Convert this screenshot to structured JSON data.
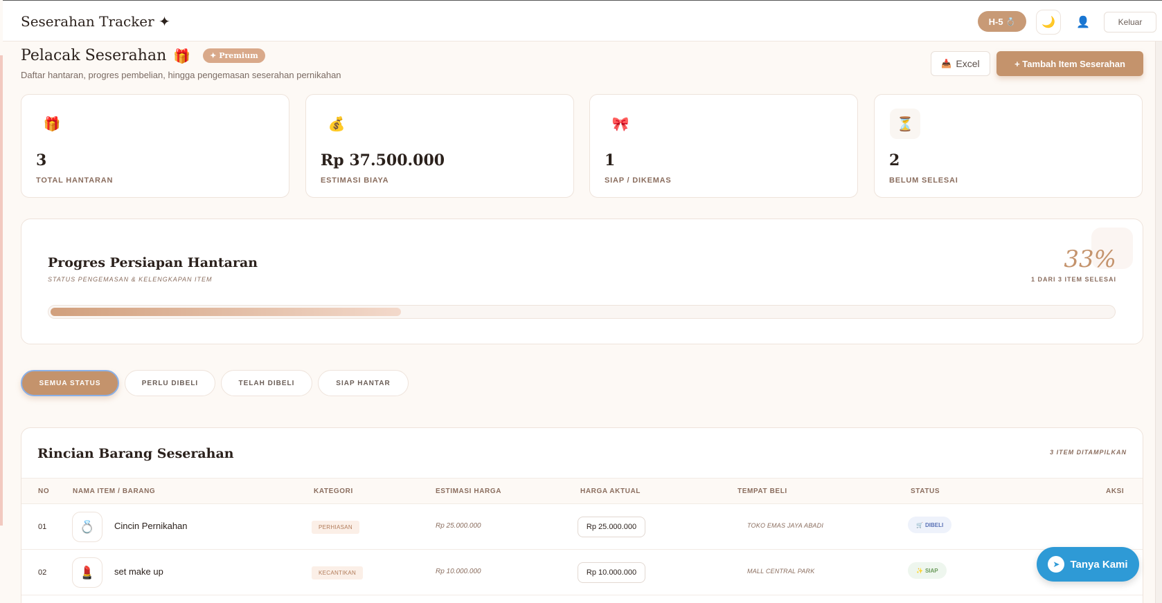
{
  "header": {
    "brand": "Seserahan Tracker ✦",
    "countdown": "H-5",
    "countdown_icon": "💍",
    "theme_icon": "🌙",
    "profile_icon": "👤",
    "logout_label": "Keluar"
  },
  "page": {
    "title": "Pelacak Seserahan",
    "title_icon": "🎁",
    "badge": "✦ Premium",
    "subtitle": "Daftar hantaran, progres pembelian, hingga pengemasan seserahan pernikahan",
    "excel_icon": "📥",
    "excel_label": "Excel",
    "add_label": "+   Tambah Item Seserahan"
  },
  "stats": [
    {
      "icon": "🎁",
      "value": "3",
      "label": "TOTAL HANTARAN"
    },
    {
      "icon": "💰",
      "value": "Rp 37.500.000",
      "label": "ESTIMASI BIAYA"
    },
    {
      "icon": "🎀",
      "value": "1",
      "label": "SIAP / DIKEMAS"
    },
    {
      "icon": "⏳",
      "value": "2",
      "label": "BELUM SELESAI"
    }
  ],
  "progress": {
    "title": "Progres Persiapan Hantaran",
    "subtitle": "STATUS PENGEMASAN & KELENGKAPAN ITEM",
    "percent_label": "33%",
    "percent_value": 33,
    "detail": "1 DARI 3 ITEM SELESAI"
  },
  "filters": [
    "SEMUA STATUS",
    "PERLU DIBELI",
    "TELAH DIBELI",
    "SIAP HANTAR"
  ],
  "table": {
    "title": "Rincian Barang Seserahan",
    "count": "3 ITEM DITAMPILKAN",
    "columns": [
      "NO",
      "NAMA ITEM / BARANG",
      "KATEGORI",
      "ESTIMASI HARGA",
      "HARGA AKTUAL",
      "TEMPAT BELI",
      "STATUS",
      "AKSI"
    ],
    "rows": [
      {
        "no": "01",
        "icon": "💍",
        "name": "Cincin Pernikahan",
        "category": "PERHIASAN",
        "estimate": "Rp 25.000.000",
        "actual": "Rp 25.000.000",
        "shop": "TOKO EMAS JAYA ABADI",
        "status_icon": "🛒",
        "status": "DIBELI"
      },
      {
        "no": "02",
        "icon": "💄",
        "name": "set make up",
        "category": "KECANTIKAN",
        "estimate": "Rp 10.000.000",
        "actual": "Rp 10.000.000",
        "shop": "MALL CENTRAL PARK",
        "status_icon": "✨",
        "status": "SIAP"
      }
    ]
  },
  "chat": {
    "icon": "➤",
    "label": "Tanya Kami"
  }
}
